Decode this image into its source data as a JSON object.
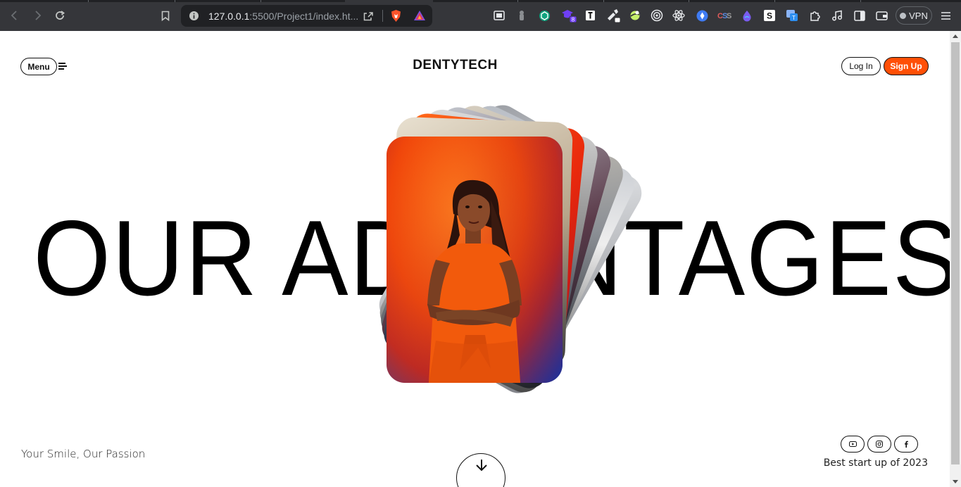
{
  "browser": {
    "url_host": "127.0.0.1",
    "url_rest": ":5500/Project1/index.ht...",
    "vpn_label": "VPN",
    "extension_icons": [
      "screen-cast-icon",
      "puzzle-pin-icon",
      "chatgpt-icon",
      "hat-badge-icon",
      "notion-icon",
      "eyedropper-icon",
      "color-ball-icon",
      "target-icon",
      "react-icon",
      "compass-icon",
      "css-icon",
      "drop-icon",
      "s-icon",
      "translate-icon",
      "extensions-icon",
      "music-icon",
      "sidebar-icon",
      "wallet-icon"
    ],
    "extension_badge": "8"
  },
  "header": {
    "menu_label": "Menu",
    "brand": "DENTYTECH",
    "login_label": "Log In",
    "signup_label": "Sign Up"
  },
  "hero": {
    "title": "OUR ADVANTAGES"
  },
  "footer": {
    "tagline": "Your Smile, Our Passion",
    "startup_text": "Best start up of 2023",
    "social": [
      "youtube-icon",
      "instagram-icon",
      "facebook-icon"
    ]
  },
  "colors": {
    "accent": "#ff4f06",
    "text": "#111111",
    "chrome_bg": "#35363a"
  }
}
